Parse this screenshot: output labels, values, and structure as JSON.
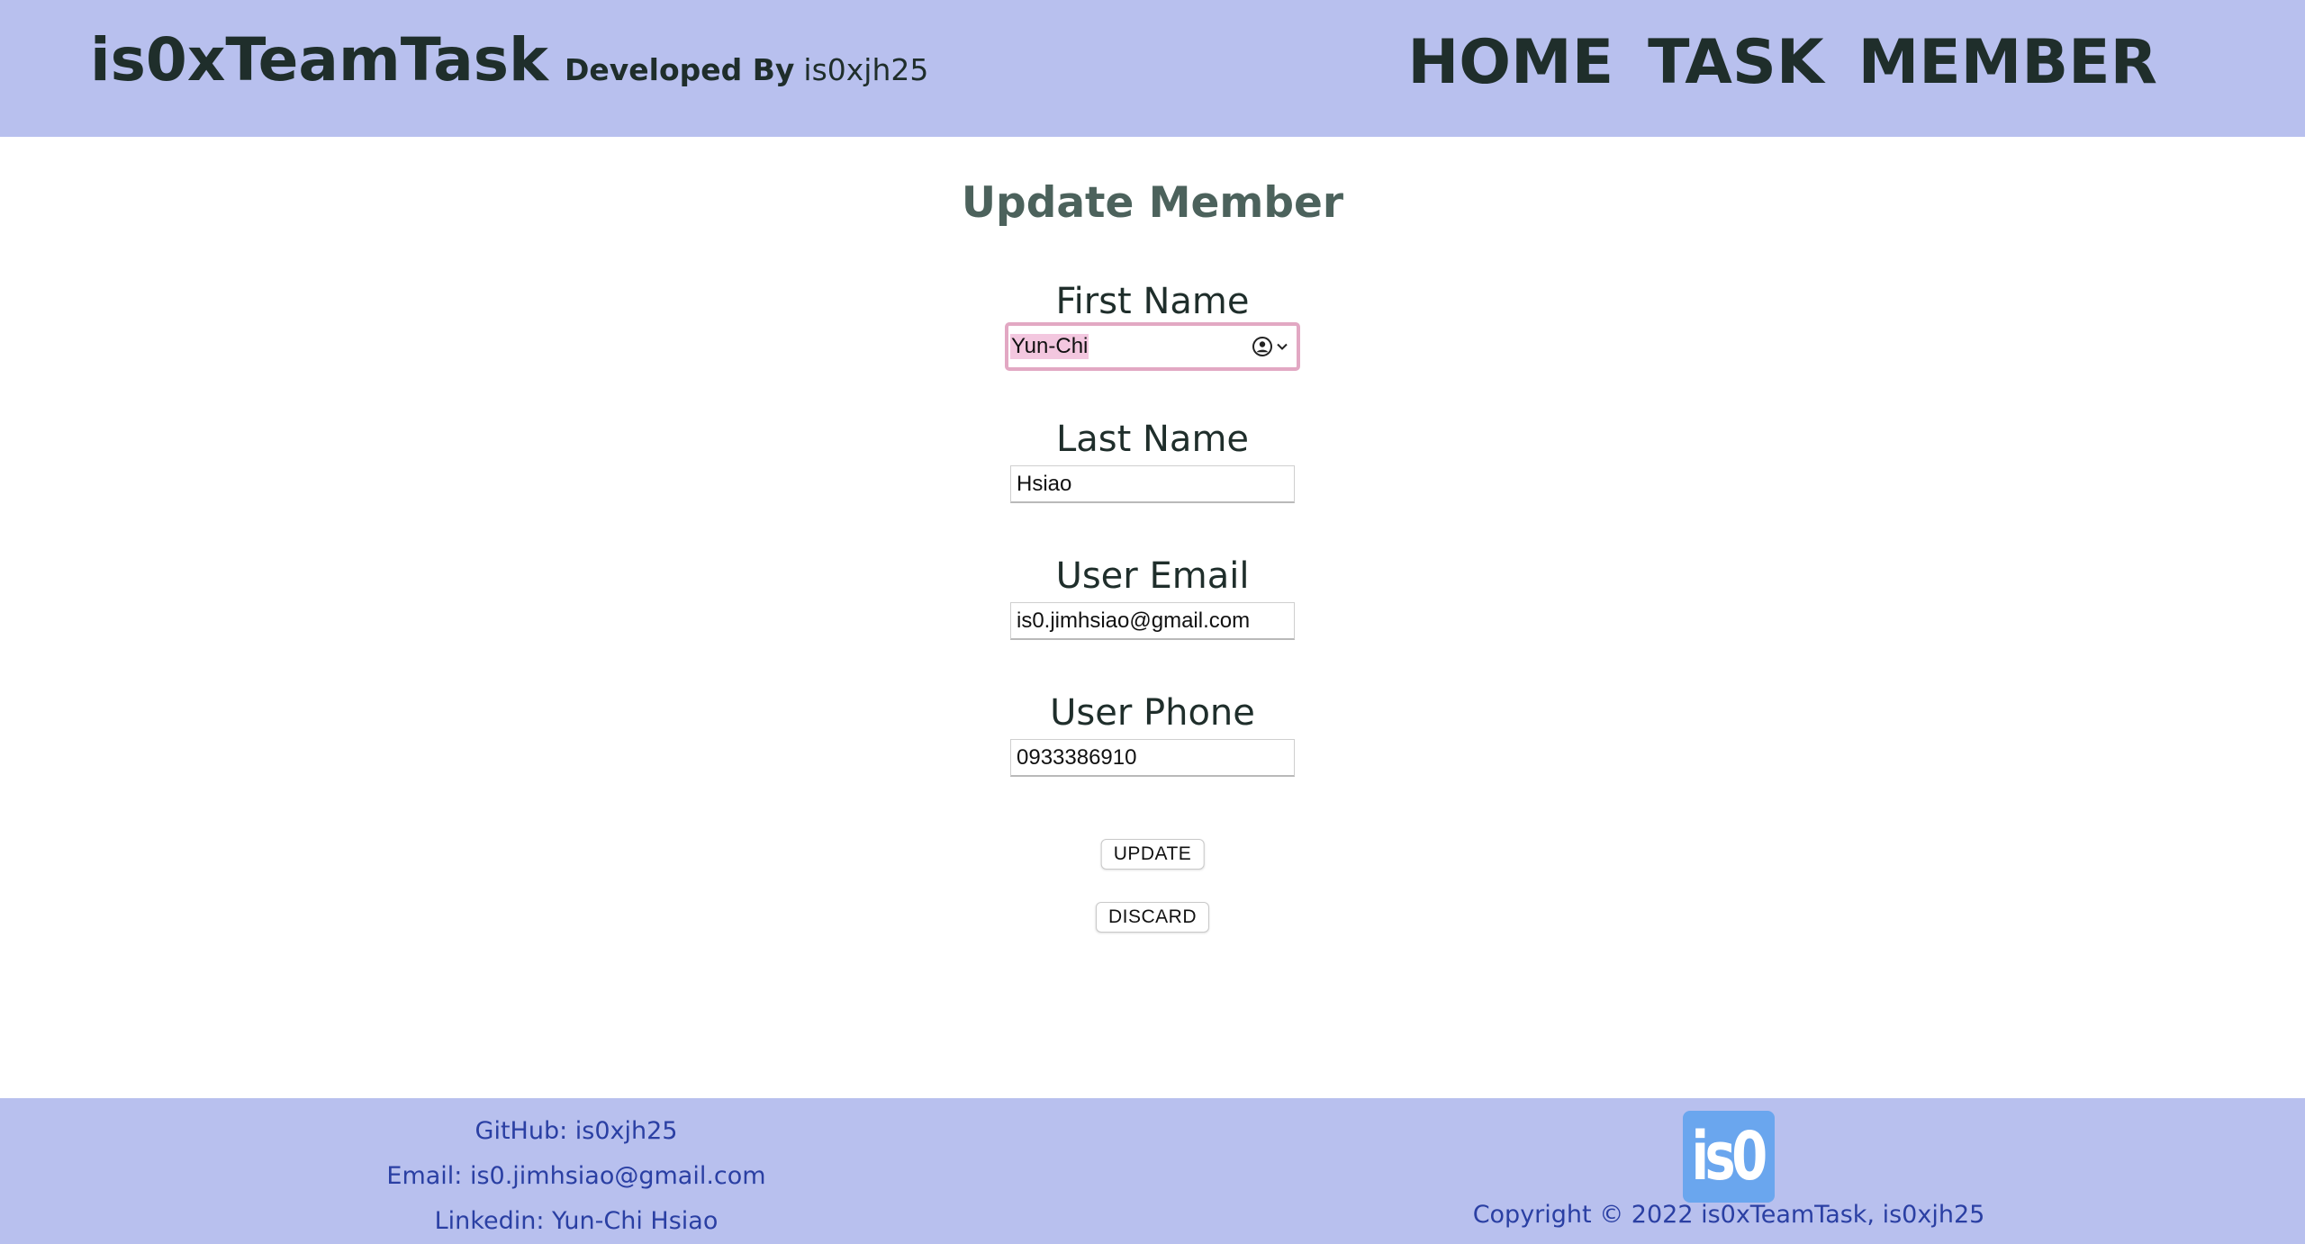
{
  "header": {
    "app_title": "is0xTeamTask",
    "developed_by_label": "Developed By",
    "developer": "is0xjh25",
    "nav": {
      "home": "HOME",
      "task": "TASK",
      "member": "MEMBER"
    }
  },
  "form": {
    "title": "Update Member",
    "first_name": {
      "label": "First Name",
      "value": "Yun-Chi"
    },
    "last_name": {
      "label": "Last Name",
      "value": "Hsiao"
    },
    "email": {
      "label": "User Email",
      "value": "is0.jimhsiao@gmail.com"
    },
    "phone": {
      "label": "User Phone",
      "value": "0933386910"
    },
    "update_label": "UPDATE",
    "discard_label": "DISCARD"
  },
  "footer": {
    "github": "GitHub: is0xjh25",
    "email": "Email: is0.jimhsiao@gmail.com",
    "linkedin": "Linkedin: Yun-Chi Hsiao",
    "logo_text": "is0",
    "copyright": "Copyright © 2022 is0xTeamTask, is0xjh25"
  },
  "colors": {
    "header_bg": "#b8c0ee",
    "footer_bg": "#b8c0ee",
    "footer_text": "#2a3fa3",
    "title_text": "#4c625c",
    "logo_bg": "#6aa6ee",
    "focus_ring": "#e2a8c3"
  },
  "icons": {
    "autofill": "user-circle-icon",
    "autofill_dropdown": "chevron-down-icon"
  }
}
